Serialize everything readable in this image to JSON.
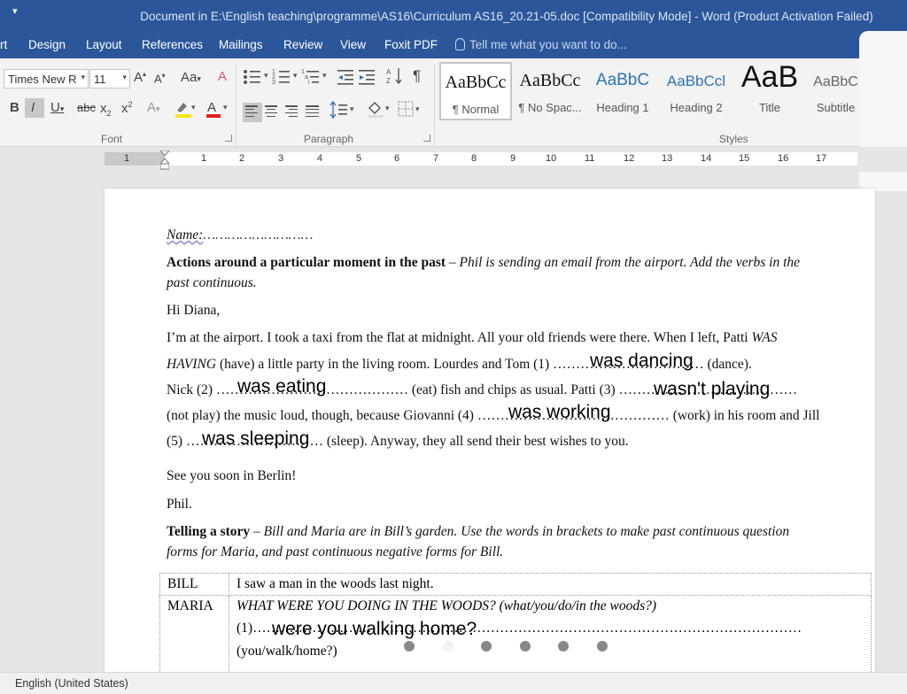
{
  "window": {
    "title": "Document in E:\\English teaching\\programme\\AS16\\Curriculum AS16_20.21-05.doc [Compatibility Mode] - Word (Product Activation Failed)"
  },
  "menu": {
    "tabs": [
      "rt",
      "Design",
      "Layout",
      "References",
      "Mailings",
      "Review",
      "View",
      "Foxit PDF"
    ],
    "tell_me": "Tell me what you want to do..."
  },
  "ribbon": {
    "font_name": "Times New R",
    "font_size": "11",
    "group_font": "Font",
    "group_paragraph": "Paragraph",
    "group_styles": "Styles",
    "styles": [
      {
        "sample": "AaBbCc",
        "label": "¶ Normal"
      },
      {
        "sample": "AaBbCc",
        "label": "¶ No Spac..."
      },
      {
        "sample": "AaBbC",
        "label": "Heading 1"
      },
      {
        "sample": "AaBbCcl",
        "label": "Heading 2"
      },
      {
        "sample": "AaB",
        "label": "Title"
      },
      {
        "sample": "AaBbC",
        "label": "Subtitle"
      }
    ]
  },
  "ruler": {
    "numbers": [
      "1",
      "1",
      "2",
      "3",
      "4",
      "5",
      "6",
      "7",
      "8",
      "9",
      "10",
      "11",
      "12",
      "13",
      "14",
      "15",
      "16",
      "17"
    ]
  },
  "document": {
    "name_label": "Name:",
    "name_dots": "………………………",
    "heading1_bold": "Actions around a particular moment in the past",
    "heading1_italic": " – Phil is sending an email from the airport. Add the verbs in the",
    "heading1_italic2": "past continuous.",
    "greeting": "Hi Diana,",
    "line1": "I’m at the airport. I took a taxi from the flat at midnight. All your old friends were there. When I left, Patti ",
    "line1_italic": "WAS",
    "line2_italic": "HAVING",
    "line2": " (have) a little party in the living room. Lourdes and Tom (1) …………………………… (dance).",
    "line3": "Nick (2) …………………………………… (eat) fish and chips as usual. Patti (3) …………………………………",
    "line4": "(not play) the music loud, though, because Giovanni (4) …………………………………… (work) in his room and Jill",
    "line5": "(5) ………………………… (sleep). Anyway, they all send their best wishes to you.",
    "see_you": "See you soon in Berlin!",
    "sign": "Phil.",
    "heading2_bold": "Telling a story",
    "heading2_italic": " – Bill and Maria are in Bill’s garden. Use the words in brackets to make past continuous question",
    "heading2_italic2": "forms for Maria, and past continuous negative forms for Bill.",
    "table": {
      "row1_speaker": "BILL",
      "row1_text": "I saw a man in the woods last night.",
      "row2_speaker": "MARIA",
      "row2_italic": "WHAT WERE YOU DOING IN THE WOODS? (what/you/do/in the woods?)",
      "row2_line2": "(1)…………………………………………………………………………………………………………",
      "row2_line3": "(you/walk/home?)"
    },
    "answers": {
      "a1": "was dancing",
      "a2": "was eating",
      "a3": "wasn't playing",
      "a4": "was working",
      "a5": "was sleeping",
      "t1": "were you walking home?"
    }
  },
  "status": {
    "language": "English (United States)"
  }
}
